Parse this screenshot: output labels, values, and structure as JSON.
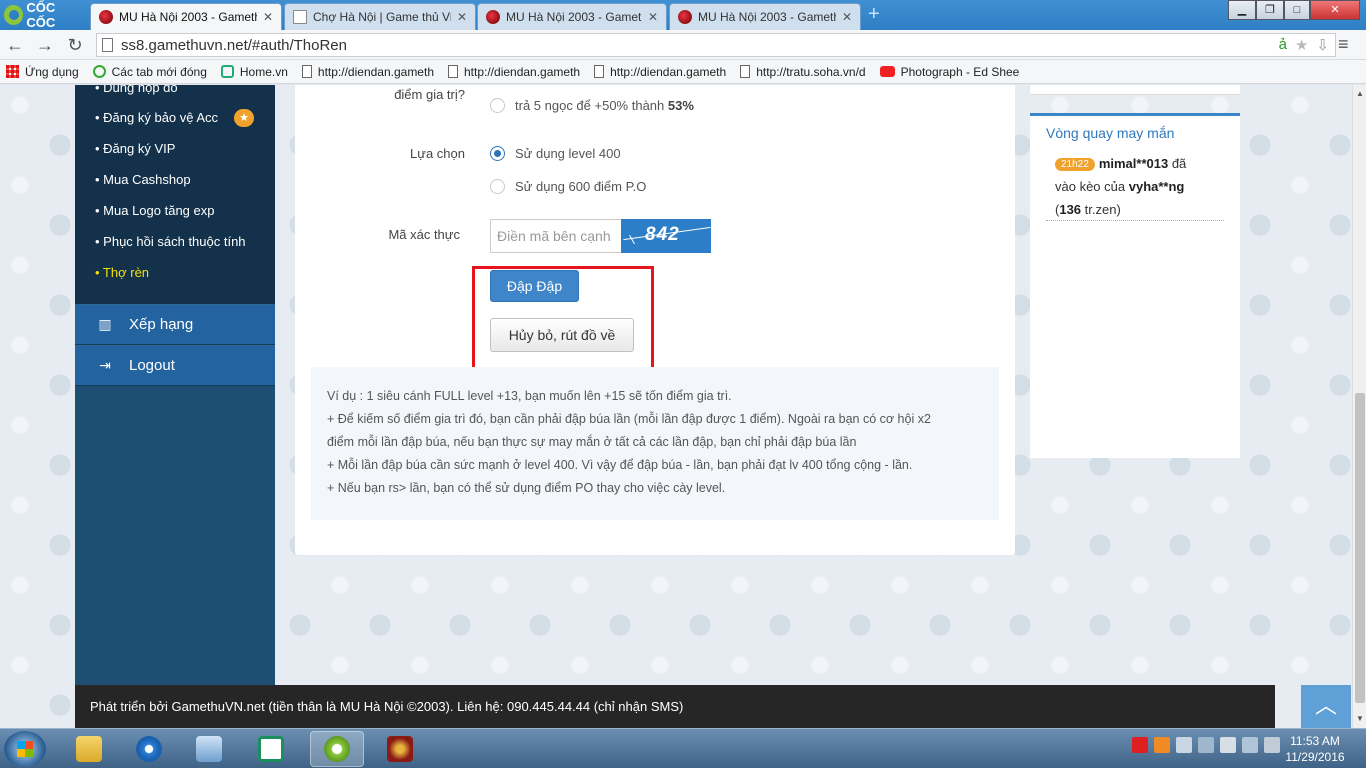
{
  "browser": {
    "brand": "CỐC CỐC",
    "tabs": [
      {
        "label": "MU Hà Nội 2003 - Gameth",
        "active": true
      },
      {
        "label": "Chợ Hà Nội | Game thủ Việ",
        "active": false
      },
      {
        "label": "MU Hà Nội 2003 - Gameth",
        "active": false
      },
      {
        "label": "MU Hà Nội 2003 - Gameth",
        "active": false
      }
    ],
    "url": "ss8.gamethuvn.net/#auth/ThoRen",
    "bookmarks": [
      {
        "label": "Ứng dụng",
        "icon": "apps-grid-icon"
      },
      {
        "label": "Các tab mới đóng",
        "icon": "recent-tabs-icon"
      },
      {
        "label": "Home.vn",
        "icon": "home-vn-icon"
      },
      {
        "label": "http://diendan.gameth",
        "icon": "page-icon"
      },
      {
        "label": "http://diendan.gameth",
        "icon": "page-icon"
      },
      {
        "label": "http://diendan.gameth",
        "icon": "page-icon"
      },
      {
        "label": "http://tratu.soha.vn/d",
        "icon": "page-icon"
      },
      {
        "label": "Photograph - Ed Shee",
        "icon": "youtube-icon"
      }
    ]
  },
  "sidebar": {
    "submenu": [
      {
        "label": "• Dùng hộp đồ",
        "active": false
      },
      {
        "label": "• Đăng ký bảo vệ Acc",
        "active": false
      },
      {
        "label": "• Đăng ký VIP",
        "active": false
      },
      {
        "label": "• Mua Cashshop",
        "active": false
      },
      {
        "label": "• Mua Logo tăng exp",
        "active": false
      },
      {
        "label": "• Phục hồi sách thuộc tính",
        "active": false
      },
      {
        "label": "• Thợ rèn",
        "active": true
      }
    ],
    "star_badge": "★",
    "main": [
      {
        "label": "Xếp hạng",
        "icon": "bar-chart-icon"
      },
      {
        "label": "Logout",
        "icon": "logout-icon"
      }
    ]
  },
  "form": {
    "value_label": "điểm gia trị?",
    "value_option": "trả 5 ngọc để +50% thành",
    "value_option_bold": "53%",
    "choice_label": "Lựa chọn",
    "choice_options": [
      "Sử dụng level 400",
      "Sử dụng 600 điểm P.O"
    ],
    "choice_selected": 0,
    "captcha_label": "Mã xác thực",
    "captcha_placeholder": "Điền mã bên cạnh",
    "captcha_text": "842",
    "submit_label": "Đập Đập",
    "cancel_label": "Hủy bỏ, rút đồ về"
  },
  "note": {
    "lines": [
      "Ví dụ : 1 siêu cánh FULL level +13, bạn muốn lên +15 sẽ tốn điểm gia trì.",
      "+ Để kiếm số điểm gia trì đó, bạn cần phải đập búa lần (mỗi lần đập được 1 điểm). Ngoài ra bạn có cơ hội x2",
      "điểm mỗi lần đập búa, nếu bạn thực sự may mắn ở tất cả các lần đập, bạn chỉ phải đập búa lần",
      "+ Mỗi lần đập búa cần sức mạnh ở level 400. Vì vậy để đập búa - lần, bạn phải đạt lv 400 tổng cộng - lần.",
      "+ Nếu bạn rs> lần, bạn có thể sử dụng điểm PO thay cho việc cày level."
    ]
  },
  "widget": {
    "title": "Vòng quay may mắn",
    "time_badge": "21h22",
    "user": "mimal**013",
    "text1": "đã",
    "text2": "vào kèo của",
    "target": "vyha**ng",
    "amount_open": "(",
    "amount": "136",
    "amount_unit": "tr.zen)"
  },
  "footer": {
    "text": "Phát triển bởi GamethuVN.net (tiền thân là MU Hà Nội ©2003). Liên hệ: 090.445.44.44 (chỉ nhận SMS)"
  },
  "taskbar": {
    "time": "11:53 AM",
    "date": "11/29/2016",
    "apps": [
      "file-explorer-icon",
      "internet-explorer-icon",
      "remote-desktop-icon",
      "home-vn-app-icon",
      "coccoc-browser-icon",
      "mu-game-icon"
    ]
  },
  "colors": {
    "sidebar_bg": "#1f4e73",
    "submenu_bg": "#13314a",
    "active_item": "#f2e10f",
    "primary_button": "#3e86c9",
    "highlight": "#e8141b",
    "footer_bg": "#262626"
  }
}
